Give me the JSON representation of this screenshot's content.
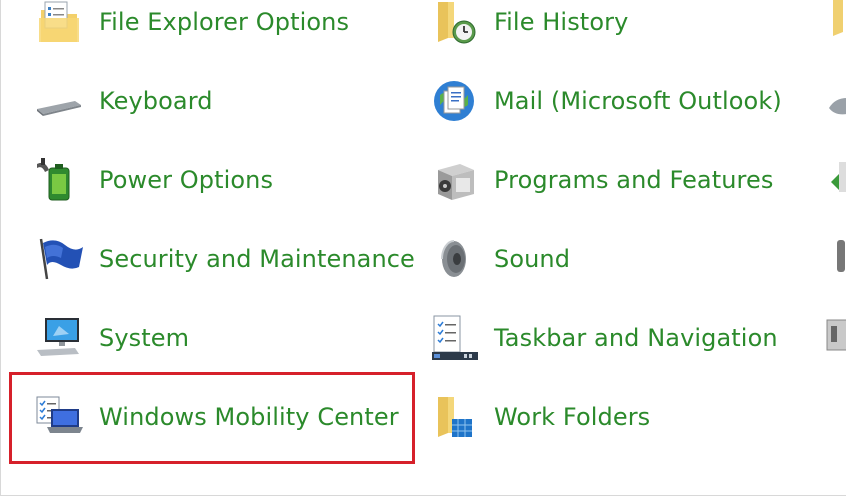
{
  "items": {
    "file_explorer_options": {
      "label": "File Explorer Options",
      "icon": "folder-options-icon"
    },
    "keyboard": {
      "label": "Keyboard",
      "icon": "keyboard-icon"
    },
    "power_options": {
      "label": "Power Options",
      "icon": "battery-plug-icon"
    },
    "security_maintenance": {
      "label": "Security and Maintenance",
      "icon": "flag-icon"
    },
    "system": {
      "label": "System",
      "icon": "computer-icon"
    },
    "windows_mobility_center": {
      "label": "Windows Mobility Center",
      "icon": "laptop-checklist-icon",
      "highlighted": true
    },
    "file_history": {
      "label": "File History",
      "icon": "folder-clock-icon"
    },
    "mail": {
      "label": "Mail (Microsoft Outlook)",
      "icon": "mail-globe-icon"
    },
    "programs_features": {
      "label": "Programs and Features",
      "icon": "programs-box-icon"
    },
    "sound": {
      "label": "Sound",
      "icon": "speaker-icon"
    },
    "taskbar_navigation": {
      "label": "Taskbar and Navigation",
      "icon": "taskbar-icon"
    },
    "work_folders": {
      "label": "Work Folders",
      "icon": "folder-blocks-icon"
    }
  },
  "colors": {
    "label": "#2b8a2b",
    "highlight": "#d6202a"
  }
}
